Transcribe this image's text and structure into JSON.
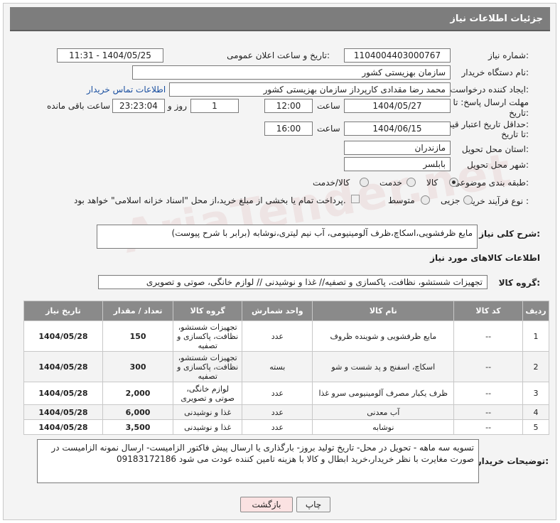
{
  "window": {
    "title": "جزئیات اطلاعات نیاز"
  },
  "watermark": "AriaTender.net",
  "form": {
    "need_number_label": "شماره نیاز:",
    "need_number": "1104004403000767",
    "announce_label": "تاریخ و ساعت اعلان عمومی:",
    "announce_value": "1404/05/25 - 11:31",
    "buyer_org_label": "نام دستگاه خریدار:",
    "buyer_org": "سازمان بهزیستی کشور",
    "creator_label": "ایجاد کننده درخواست:",
    "creator": "محمد رضا  مقدادی کارپرداز سازمان بهزیستی کشور",
    "contact_link": "اطلاعات تماس خریدار",
    "deadline_label_1": "مهلت ارسال پاسخ: تا",
    "deadline_label_2": "تاریخ:",
    "deadline_date": "1404/05/27",
    "hour_label": "ساعت",
    "deadline_time": "12:00",
    "days_value": "1",
    "days_label": "روز و",
    "remaining_time": "23:23:04",
    "remaining_label": "ساعت باقی مانده",
    "min_validity_label_1": "حداقل تاریخ اعتبار قیمت:",
    "min_validity_label_2": "تا تاریخ:",
    "validity_date": "1404/06/15",
    "validity_time": "16:00",
    "province_label": "استان محل تحویل:",
    "province": "مازندران",
    "city_label": "شهر محل تحویل:",
    "city": "بابلسر",
    "category_label": "طبقه بندی موضوعی:",
    "category_options": [
      "کالا",
      "خدمت",
      "کالا/خدمت"
    ],
    "process_label": "نوع فرآیند خرید :",
    "process_options": [
      "جزیی",
      "متوسط"
    ],
    "payment_note": "پرداخت تمام یا بخشی از مبلغ خرید،از محل \"اسناد خزانه اسلامی\" خواهد بود."
  },
  "summary": {
    "label": "شرح کلی نیاز:",
    "text": "مایع ظرفشویی،اسکاچ،ظرف آلومینیومی، آب نیم لیتری،نوشابه (برابر با شرح پیوست)"
  },
  "goods_section": {
    "title": "اطلاعات کالاهای مورد نیاز",
    "group_label": "گروه کالا:",
    "group_value": "تجهیزات شستشو، نظافت، پاکسازی و تصفیه// غذا و نوشیدنی // لوازم خانگی، صوتی و تصویری"
  },
  "table": {
    "headers": [
      "ردیف",
      "کد کالا",
      "نام کالا",
      "واحد شمارش",
      "گروه کالا",
      "تعداد / مقدار",
      "تاریخ نیاز"
    ],
    "rows": [
      {
        "idx": "1",
        "code": "--",
        "name": "مایع ظرفشویی و شوینده ظروف",
        "unit": "عدد",
        "group": "تجهیزات شستشو، نظافت، پاکسازی و تصفیه",
        "qty": "150",
        "date": "1404/05/28"
      },
      {
        "idx": "2",
        "code": "--",
        "name": "اسکاچ، اسفنج و پد شست و شو",
        "unit": "بسته",
        "group": "تجهیزات شستشو، نظافت، پاکسازی و تصفیه",
        "qty": "300",
        "date": "1404/05/28"
      },
      {
        "idx": "3",
        "code": "--",
        "name": "ظرف یکبار مصرف آلومینیومی سرو غذا",
        "unit": "عدد",
        "group": "لوازم خانگی، صوتی و تصویری",
        "qty": "2,000",
        "date": "1404/05/28"
      },
      {
        "idx": "4",
        "code": "--",
        "name": "آب معدنی",
        "unit": "عدد",
        "group": "غذا و نوشیدنی",
        "qty": "6,000",
        "date": "1404/05/28"
      },
      {
        "idx": "5",
        "code": "--",
        "name": "نوشابه",
        "unit": "عدد",
        "group": "غذا و نوشیدنی",
        "qty": "3,500",
        "date": "1404/05/28"
      }
    ]
  },
  "notes": {
    "label": "توضیحات خریدار:",
    "text": "تسویه سه ماهه - تحویل در محل- تاریخ تولید بروز- بارگذاری یا ارسال پیش فاکتور الزامیست- ارسال نمونه الزامیست در صورت مغایرت با نظر خریدار،خرید ابطال و کالا با هزینه تامین کننده عودت می شود 09183172186"
  },
  "buttons": {
    "print": "چاپ",
    "back": "بازگشت"
  }
}
